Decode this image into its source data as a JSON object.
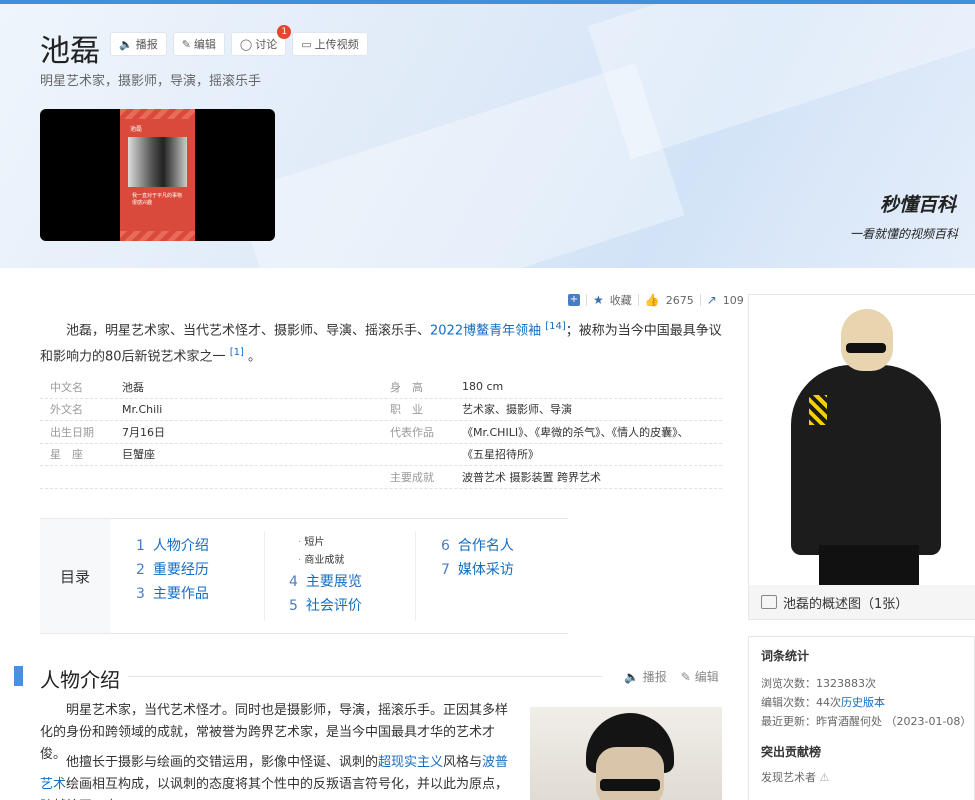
{
  "header": {
    "title": "池磊",
    "subtitle": "明星艺术家，摄影师，导演，摇滚乐手",
    "buttons": [
      {
        "label": "播报",
        "icon": "speaker-icon"
      },
      {
        "label": "编辑",
        "icon": "pencil-icon"
      },
      {
        "label": "讨论",
        "icon": "chat-icon",
        "badge": "1"
      },
      {
        "label": "上传视频",
        "icon": "video-icon"
      }
    ],
    "video": {
      "poster_title": "池磊",
      "poster_caption": "我一直对于平凡的事物很感兴趣"
    },
    "logo": "秒懂百科",
    "slogan": "一看就懂的视频百科"
  },
  "toolbar": {
    "collect": "收藏",
    "likes": "2675",
    "shares": "109"
  },
  "summary": {
    "text1": "池磊，明星艺术家、当代艺术怪才、摄影师、导演、摇滚乐手、",
    "link": "2022博鳌青年领袖",
    "ref1": "[14]",
    "text2": "；被称为当今中国最具争议和影响力的80后新锐艺术家之一",
    "ref2": "[1]",
    "text3": "。"
  },
  "infobox": {
    "left": [
      {
        "label": "中文名",
        "value": "池磊"
      },
      {
        "label": "外文名",
        "value": "Mr.Chili"
      },
      {
        "label": "出生日期",
        "value": "7月16日"
      },
      {
        "label": "星　座",
        "value": "巨蟹座"
      },
      {
        "label": "",
        "value": ""
      }
    ],
    "right": [
      {
        "label": "身　高",
        "value": "180 cm"
      },
      {
        "label": "职　业",
        "value": "艺术家、摄影师、导演"
      },
      {
        "label": "代表作品",
        "value": "《Mr.CHILI》、《卑微的杀气》、《情人的皮囊》、"
      },
      {
        "label": "",
        "value": "《五星招待所》"
      },
      {
        "label": "主要成就",
        "value": "波普艺术 摄影装置 跨界艺术"
      }
    ]
  },
  "toc": {
    "title": "目录",
    "items": [
      {
        "num": "1",
        "label": "人物介绍"
      },
      {
        "num": "2",
        "label": "重要经历"
      },
      {
        "num": "3",
        "label": "主要作品"
      },
      {
        "num": "4",
        "label": "主要展览"
      },
      {
        "num": "5",
        "label": "社会评价"
      },
      {
        "num": "6",
        "label": "合作名人"
      },
      {
        "num": "7",
        "label": "媒体采访"
      }
    ],
    "subs": [
      "短片",
      "商业成就"
    ]
  },
  "side": {
    "photo_caption": "池磊的概述图（1张）",
    "stats_title": "词条统计",
    "views_label": "浏览次数：",
    "views": "1323883次",
    "edits_label": "编辑次数：",
    "edits": "44次",
    "history_link": "历史版本",
    "updated_label": "最近更新：",
    "updated": "昨宵酒醒何处 （2023-01-08）",
    "contrib_title": "突出贡献榜",
    "contrib_item": "发现艺术者"
  },
  "section": {
    "title": "人物介绍",
    "broadcast": "播报",
    "edit": "编辑",
    "p1": "明星艺术家，当代艺术怪才。同时也是摄影师，导演，摇滚乐手。正因其多样化的身份和跨领域的成就，常被誉为跨界艺术家，是当今中国最具才华的艺术才俊。",
    "p2a": "他擅长于摄影与绘画的交错运用，影像中怪诞、讽刺的",
    "p2link1": "超现实主义",
    "p2b": "风格与",
    "p2link2": "波普艺术",
    "p2c": "绘画相互构成，以讽刺的态度将其个性中的反叛语言符号化，并以此为原点，跨越绘画、电"
  }
}
